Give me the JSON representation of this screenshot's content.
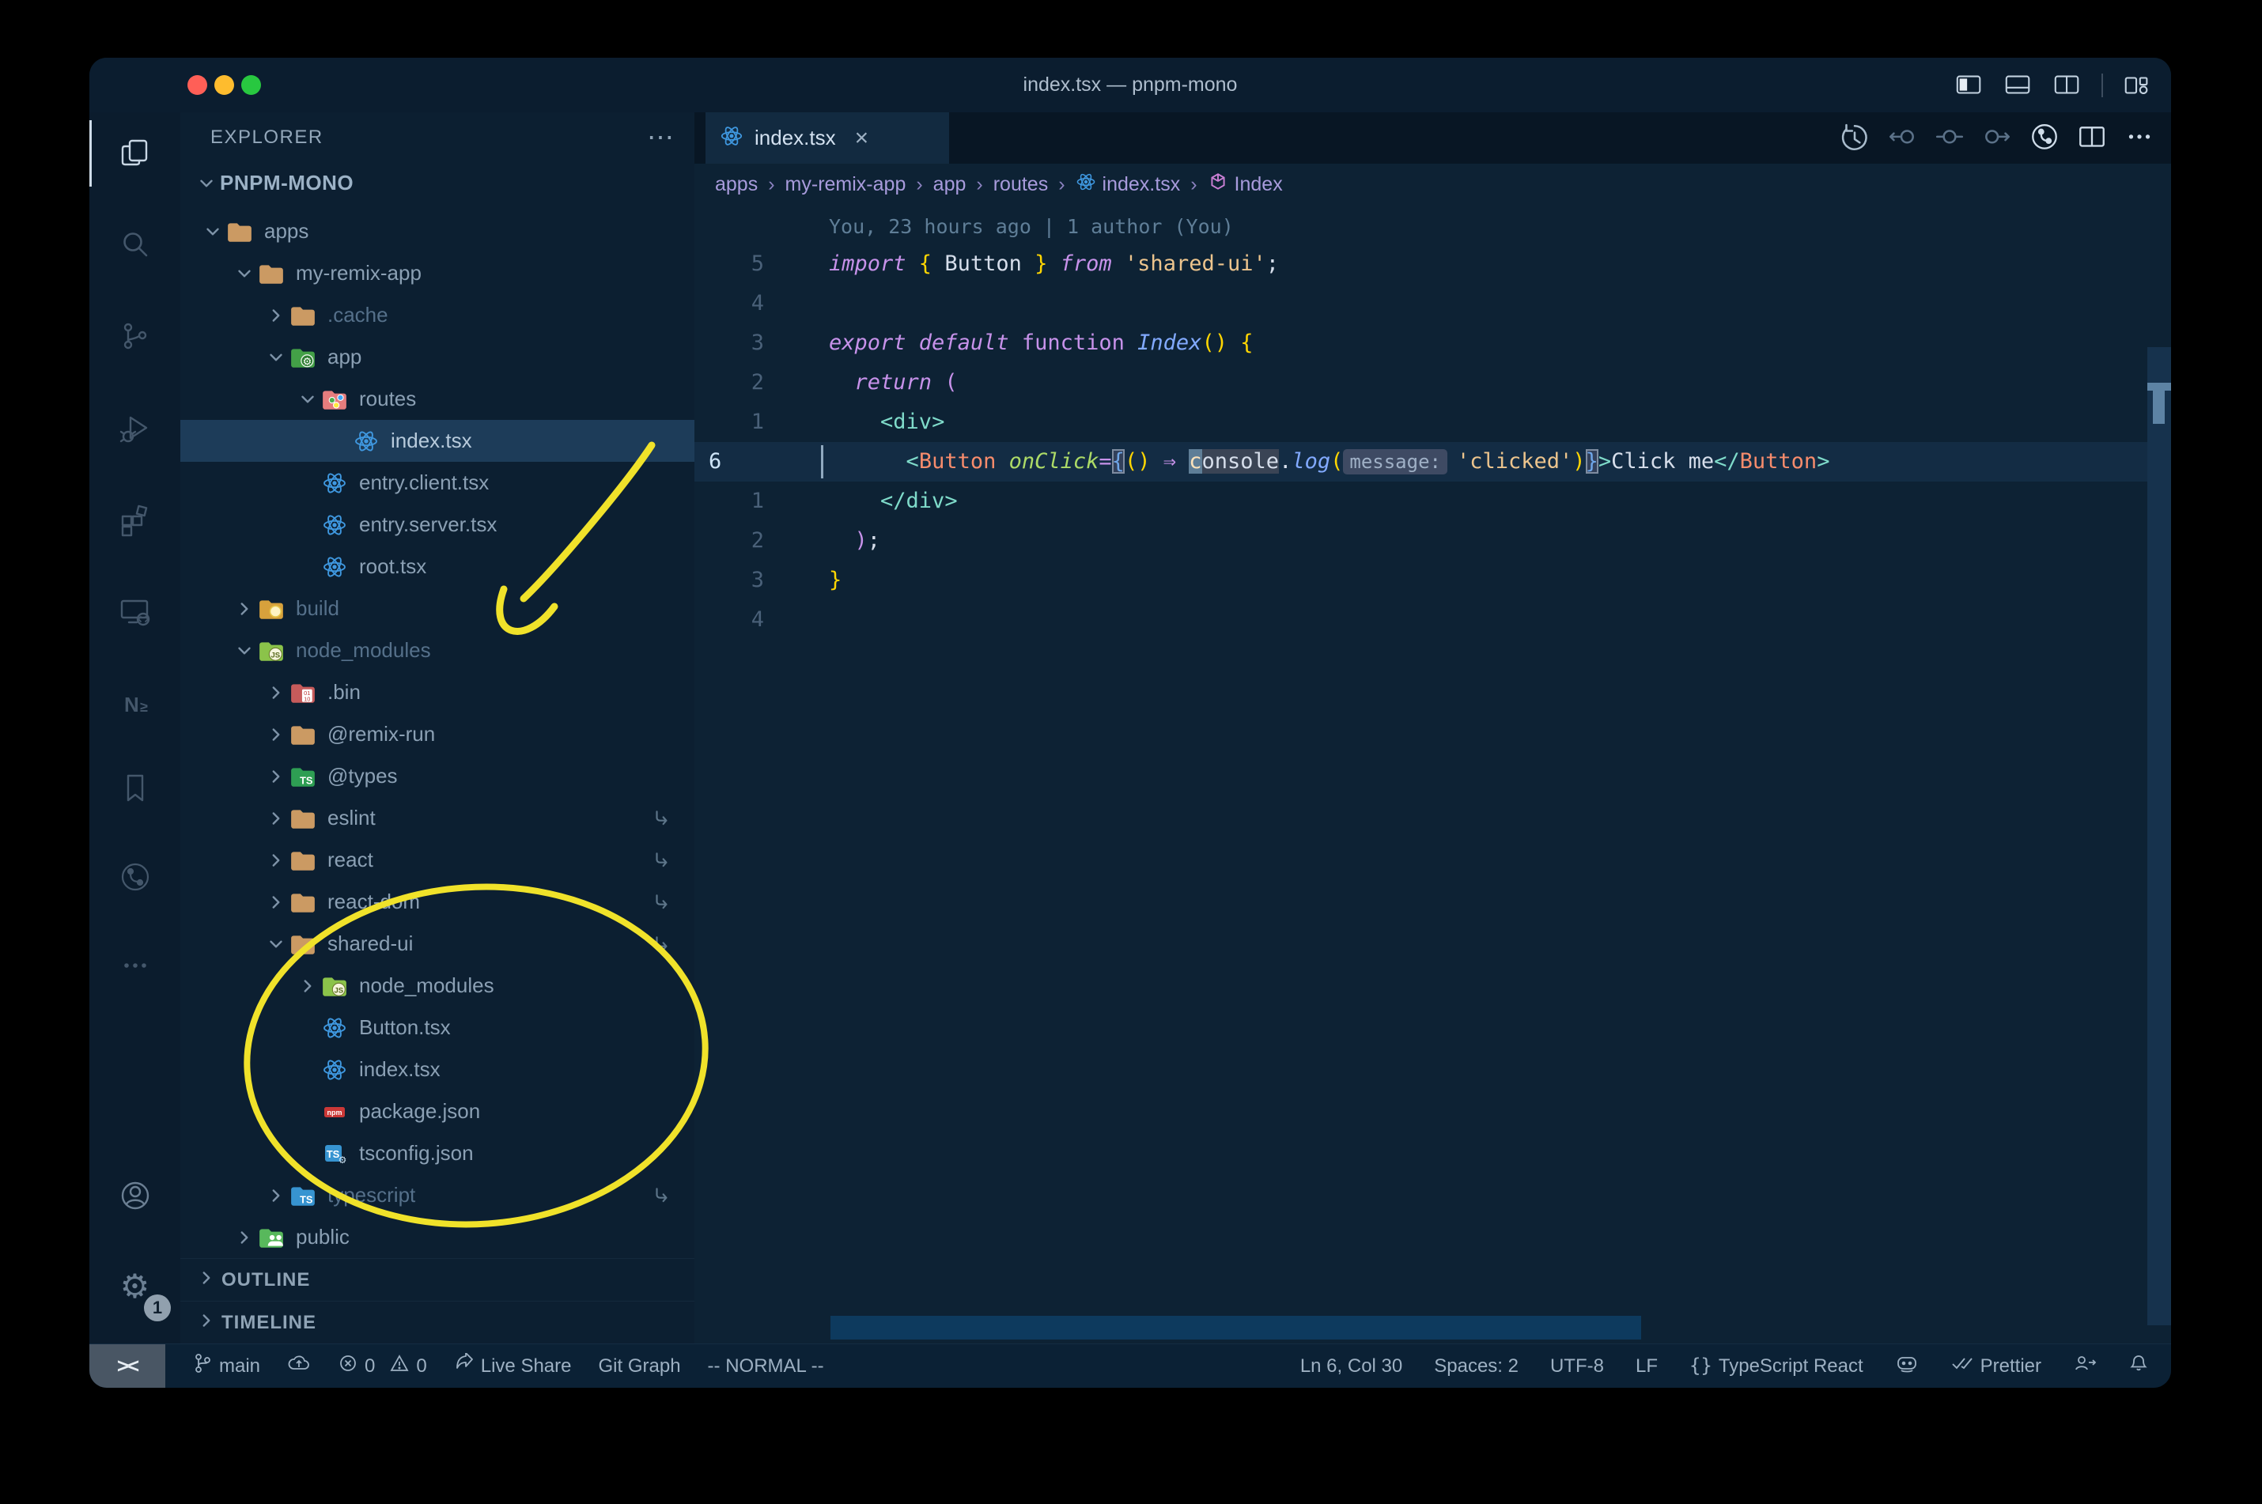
{
  "window": {
    "title": "index.tsx — pnpm-mono"
  },
  "colors": {
    "annotation_yellow": "#f0e22a",
    "traffic_close": "#ff5f57",
    "traffic_min": "#febc2e",
    "traffic_max": "#28c840",
    "react_blue": "#3f98e0",
    "folder_tan": "#cb9a63",
    "npm_red": "#cb3837",
    "ts_blue": "#3178c6",
    "selected_row": "#1d3c59",
    "string_orange": "#ecc48d",
    "keyword_pink": "#c792ea"
  },
  "activity_bar": {
    "top": [
      {
        "name": "explorer",
        "active": true
      },
      {
        "name": "search"
      },
      {
        "name": "source-control"
      },
      {
        "name": "run-debug"
      },
      {
        "name": "extensions"
      },
      {
        "name": "remote-explorer"
      },
      {
        "name": "nx-console"
      }
    ],
    "middle": [
      {
        "name": "bookmarks"
      },
      {
        "name": "git-graph"
      },
      {
        "name": "more-views"
      }
    ],
    "bottom": [
      {
        "name": "accounts"
      },
      {
        "name": "settings"
      }
    ],
    "settings_badge": "1"
  },
  "sidebar": {
    "header": "EXPLORER",
    "header_more": "⋯",
    "root": "PNPM-MONO",
    "tree": [
      {
        "label": "apps",
        "depth": 0,
        "chev": "d",
        "icon": "folder"
      },
      {
        "label": "my-remix-app",
        "depth": 1,
        "chev": "d",
        "icon": "folder"
      },
      {
        "label": ".cache",
        "depth": 2,
        "chev": "r",
        "icon": "folder",
        "dim": 1
      },
      {
        "label": "app",
        "depth": 2,
        "chev": "d",
        "icon": "folder-app"
      },
      {
        "label": "routes",
        "depth": 3,
        "chev": "d",
        "icon": "folder-routes"
      },
      {
        "label": "index.tsx",
        "depth": 4,
        "chev": "",
        "icon": "react",
        "sel": 1
      },
      {
        "label": "entry.client.tsx",
        "depth": 3,
        "chev": "",
        "icon": "react"
      },
      {
        "label": "entry.server.tsx",
        "depth": 3,
        "chev": "",
        "icon": "react"
      },
      {
        "label": "root.tsx",
        "depth": 3,
        "chev": "",
        "icon": "react"
      },
      {
        "label": "build",
        "depth": 1,
        "chev": "r",
        "icon": "folder-build",
        "dim": 1
      },
      {
        "label": "node_modules",
        "depth": 1,
        "chev": "d",
        "icon": "folder-nm",
        "dim": 1
      },
      {
        "label": ".bin",
        "depth": 2,
        "chev": "r",
        "icon": "folder-bin"
      },
      {
        "label": "@remix-run",
        "depth": 2,
        "chev": "r",
        "icon": "folder"
      },
      {
        "label": "@types",
        "depth": 2,
        "chev": "r",
        "icon": "folder-types"
      },
      {
        "label": "eslint",
        "depth": 2,
        "chev": "r",
        "icon": "folder",
        "sym": 1
      },
      {
        "label": "react",
        "depth": 2,
        "chev": "r",
        "icon": "folder",
        "sym": 1
      },
      {
        "label": "react-dom",
        "depth": 2,
        "chev": "r",
        "icon": "folder",
        "sym": 1
      },
      {
        "label": "shared-ui",
        "depth": 2,
        "chev": "d",
        "icon": "folder",
        "sym": 1
      },
      {
        "label": "node_modules",
        "depth": 3,
        "chev": "r",
        "icon": "folder-nm"
      },
      {
        "label": "Button.tsx",
        "depth": 3,
        "chev": "",
        "icon": "react"
      },
      {
        "label": "index.tsx",
        "depth": 3,
        "chev": "",
        "icon": "react"
      },
      {
        "label": "package.json",
        "depth": 3,
        "chev": "",
        "icon": "npm"
      },
      {
        "label": "tsconfig.json",
        "depth": 3,
        "chev": "",
        "icon": "tsconfig"
      },
      {
        "label": "typescript",
        "depth": 2,
        "chev": "r",
        "icon": "folder-ts",
        "dim": 1,
        "sym": 1
      },
      {
        "label": "public",
        "depth": 1,
        "chev": "r",
        "icon": "folder-public"
      }
    ],
    "sections": [
      "OUTLINE",
      "TIMELINE"
    ]
  },
  "tabs": [
    {
      "label": "index.tsx",
      "icon": "react",
      "close": "×",
      "active": true
    }
  ],
  "editor_toolbar": [
    "history",
    "prev-change",
    "change",
    "next-change",
    "commit",
    "split",
    "more"
  ],
  "title_icons": [
    "layout-sidebar",
    "layout-panel",
    "layout-split",
    "divider",
    "layout-custom"
  ],
  "breadcrumbs": {
    "separator": "›",
    "items": [
      {
        "label": "apps"
      },
      {
        "label": "my-remix-app"
      },
      {
        "label": "app"
      },
      {
        "label": "routes"
      },
      {
        "label": "index.tsx",
        "icon": "react"
      },
      {
        "label": "Index",
        "icon": "symbol"
      }
    ]
  },
  "editor": {
    "blame": "You, 23 hours ago | 1 author (You)",
    "lines": [
      {
        "num": "5",
        "tokens": [
          [
            "kw",
            "import "
          ],
          [
            "g",
            "{"
          ],
          [
            "w",
            " Button "
          ],
          [
            "g",
            "}"
          ],
          [
            "kw",
            " from "
          ],
          [
            "s",
            "'shared-ui'"
          ],
          [
            "w",
            ";"
          ]
        ]
      },
      {
        "num": "4",
        "tokens": []
      },
      {
        "num": "3",
        "tokens": [
          [
            "kw",
            "export "
          ],
          [
            "kw",
            "default "
          ],
          [
            "kw2",
            "function "
          ],
          [
            "fn",
            "Index"
          ],
          [
            "g",
            "()"
          ],
          [
            "w",
            " "
          ],
          [
            "g",
            "{"
          ]
        ]
      },
      {
        "num": "2",
        "tokens": [
          [
            "w",
            "  "
          ],
          [
            "kw",
            "return "
          ],
          [
            "pk",
            "("
          ]
        ]
      },
      {
        "num": "1",
        "tokens": [
          [
            "w",
            "    "
          ],
          [
            "tb",
            "<"
          ],
          [
            "tg",
            "div"
          ],
          [
            "tb",
            ">"
          ]
        ]
      },
      {
        "num": "6",
        "cur": 1,
        "tokens": [
          [
            "w",
            "      "
          ],
          [
            "tb",
            "<"
          ],
          [
            "cp",
            "Button"
          ],
          [
            "at",
            " onClick"
          ],
          [
            "op",
            "="
          ],
          [
            "bb",
            "{"
          ],
          [
            "g",
            "()"
          ],
          [
            "w",
            " "
          ],
          [
            "op",
            "⇒"
          ],
          [
            "w",
            " "
          ],
          [
            "cur",
            "c"
          ],
          [
            "wh",
            "onsole"
          ],
          [
            "w",
            "."
          ],
          [
            "fn",
            "log"
          ],
          [
            "g",
            "("
          ],
          [
            "inl",
            "message:"
          ],
          [
            "s",
            "'clicked'"
          ],
          [
            "g",
            ")"
          ],
          [
            "bb",
            "}"
          ],
          [
            "tb",
            ">"
          ],
          [
            "w",
            "Click me"
          ],
          [
            "tb",
            "</"
          ],
          [
            "cp",
            "Button"
          ],
          [
            "tb",
            ">"
          ]
        ]
      },
      {
        "num": "1",
        "tokens": [
          [
            "w",
            "    "
          ],
          [
            "tb",
            "</"
          ],
          [
            "tg",
            "div"
          ],
          [
            "tb",
            ">"
          ]
        ]
      },
      {
        "num": "2",
        "tokens": [
          [
            "w",
            "  "
          ],
          [
            "pk",
            ")"
          ],
          [
            "w",
            ";"
          ]
        ]
      },
      {
        "num": "3",
        "tokens": [
          [
            "g",
            "}"
          ]
        ]
      },
      {
        "num": "4",
        "tokens": []
      }
    ]
  },
  "status_bar": {
    "remote": "><",
    "left": [
      {
        "icon": "branch",
        "label": "main"
      },
      {
        "icon": "cloud",
        "label": ""
      },
      {
        "icon": "error",
        "label": "0",
        "icon2": "warning",
        "label2": "0"
      },
      {
        "icon": "share",
        "label": "Live Share"
      },
      {
        "label": "Git Graph"
      },
      {
        "label": "-- NORMAL --"
      }
    ],
    "right": [
      {
        "label": "Ln 6, Col 30"
      },
      {
        "label": "Spaces: 2"
      },
      {
        "label": "UTF-8"
      },
      {
        "label": "LF"
      },
      {
        "icon": "braces",
        "label": "TypeScript React"
      },
      {
        "icon": "copilot",
        "label": ""
      },
      {
        "icon": "check-double",
        "label": "Prettier"
      },
      {
        "icon": "person-go",
        "label": ""
      },
      {
        "icon": "bell",
        "label": ""
      }
    ]
  }
}
